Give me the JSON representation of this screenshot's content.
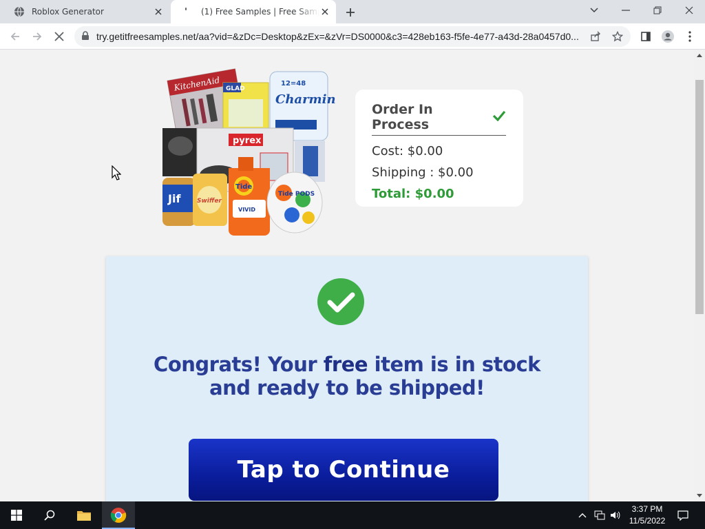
{
  "browser": {
    "tabs": [
      {
        "title": "Roblox Generator",
        "active": false,
        "icon": "globe-icon"
      },
      {
        "title": "(1) Free Samples | Free Samples -",
        "active": true,
        "icon": "loading-icon"
      }
    ],
    "url": "try.getitfreesamples.net/aa?vid=&zDc=Desktop&zEx=&zVr=DS0000&c3=428eb163-f5fe-4e77-a43d-28a0457d0..."
  },
  "page": {
    "order": {
      "title": "Order In Process",
      "cost": "Cost: $0.00",
      "shipping": "Shipping : $0.00",
      "total": "Total: $0.00"
    },
    "congrats": {
      "line1_pre": "Congrats! Your ",
      "line1_free": "free",
      "line1_post": " item is in stock",
      "line2": "and ready to be shipped!"
    },
    "cta_label": "Tap to Continue",
    "product_brands": [
      "KitchenAid",
      "GLAD",
      "Charmin",
      "pyrex",
      "Jif",
      "Swiffer",
      "Tide",
      "Tide PODS"
    ]
  },
  "taskbar": {
    "time": "3:37 PM",
    "date": "11/5/2022"
  },
  "colors": {
    "accent_green": "#2e9b38",
    "heading_blue": "#2a3d94",
    "button_blue": "#0a1d9c",
    "panel_bg": "#dfedf8"
  }
}
